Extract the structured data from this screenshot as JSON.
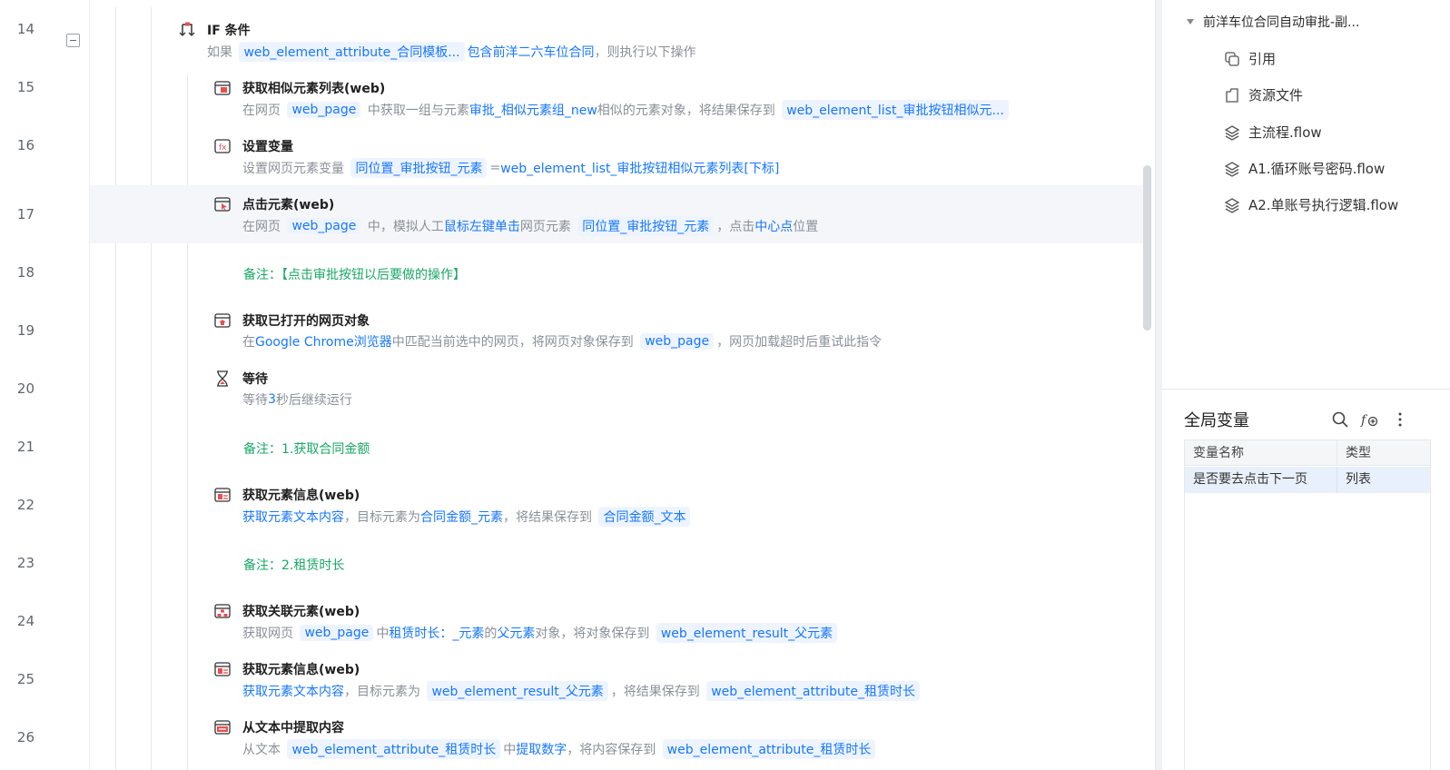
{
  "rows": [
    {
      "line": "14",
      "title": "IF 条件",
      "desc": [
        {
          "t": "如果 "
        },
        {
          "t": "web_element_attribute_合同模板...",
          "c": "tag"
        },
        {
          "t": "包含",
          "c": "kw"
        },
        {
          "t": "前洋二六车位合同",
          "c": "kw"
        },
        {
          "t": "，则执行以下操作"
        }
      ]
    },
    {
      "line": "15",
      "title": "获取相似元素列表(web)",
      "desc": [
        {
          "t": "在网页 "
        },
        {
          "t": "web_page",
          "c": "tag"
        },
        {
          "t": " 中获取一组与元素"
        },
        {
          "t": "审批_相似元素组_new",
          "c": "kw"
        },
        {
          "t": "相似的元素对象，将结果保存到 "
        },
        {
          "t": "web_element_list_审批按钮相似元...",
          "c": "tag"
        }
      ]
    },
    {
      "line": "16",
      "title": "设置变量",
      "desc": [
        {
          "t": "设置网页元素变量 "
        },
        {
          "t": "同位置_审批按钮_元素",
          "c": "tag"
        },
        {
          "t": "="
        },
        {
          "t": "web_element_list_审批按钮相似元素列表[下标]",
          "c": "kw"
        }
      ]
    },
    {
      "line": "17",
      "title": "点击元素(web)",
      "desc": [
        {
          "t": "在网页 "
        },
        {
          "t": "web_page",
          "c": "tag"
        },
        {
          "t": " 中，模拟人工"
        },
        {
          "t": "鼠标左键单击",
          "c": "kw"
        },
        {
          "t": "网页元素 "
        },
        {
          "t": "同位置_审批按钮_元素",
          "c": "tag"
        },
        {
          "t": "，点击"
        },
        {
          "t": "中心点",
          "c": "kw"
        },
        {
          "t": "位置"
        }
      ]
    },
    {
      "line": "18",
      "note": "备注：【点击审批按钮以后要做的操作】"
    },
    {
      "line": "19",
      "title": "获取已打开的网页对象",
      "desc": [
        {
          "t": "在"
        },
        {
          "t": "Google Chrome浏览器",
          "c": "kw"
        },
        {
          "t": "中匹配当前选中的网页，将网页对象保存到 "
        },
        {
          "t": "web_page",
          "c": "tag"
        },
        {
          "t": "，网页加载超时后重试此指令"
        }
      ]
    },
    {
      "line": "20",
      "title": "等待",
      "desc": [
        {
          "t": "等待"
        },
        {
          "t": "3",
          "c": "kw"
        },
        {
          "t": "秒后继续运行"
        }
      ]
    },
    {
      "line": "21",
      "note": "备注：1.获取合同金额"
    },
    {
      "line": "22",
      "title": "获取元素信息(web)",
      "desc": [
        {
          "t": "获取元素文本内容",
          "c": "kw"
        },
        {
          "t": "，目标元素为"
        },
        {
          "t": "合同金额_元素",
          "c": "kw"
        },
        {
          "t": "，将结果保存到 "
        },
        {
          "t": "合同金额_文本",
          "c": "tag"
        }
      ]
    },
    {
      "line": "23",
      "note": "备注：2.租赁时长"
    },
    {
      "line": "24",
      "title": "获取关联元素(web)",
      "desc": [
        {
          "t": "获取网页 "
        },
        {
          "t": "web_page",
          "c": "tag"
        },
        {
          "t": "中"
        },
        {
          "t": "租赁时长：_元素",
          "c": "kw"
        },
        {
          "t": "的"
        },
        {
          "t": "父元素",
          "c": "kw"
        },
        {
          "t": "对象，将对象保存到 "
        },
        {
          "t": "web_element_result_父元素",
          "c": "tag"
        }
      ]
    },
    {
      "line": "25",
      "title": "获取元素信息(web)",
      "desc": [
        {
          "t": "获取元素文本内容",
          "c": "kw"
        },
        {
          "t": "，目标元素为 "
        },
        {
          "t": "web_element_result_父元素",
          "c": "tag"
        },
        {
          "t": "，将结果保存到 "
        },
        {
          "t": "web_element_attribute_租赁时长",
          "c": "tag"
        }
      ]
    },
    {
      "line": "26",
      "title": "从文本中提取内容",
      "desc": [
        {
          "t": "从文本 "
        },
        {
          "t": "web_element_attribute_租赁时长",
          "c": "tag"
        },
        {
          "t": "中"
        },
        {
          "t": "提取数字",
          "c": "kw"
        },
        {
          "t": "，将内容保存到 "
        },
        {
          "t": "web_element_attribute_租赁时长",
          "c": "tag"
        }
      ]
    }
  ],
  "tree": {
    "root": "前洋车位合同自动审批-副...",
    "items": [
      "引用",
      "资源文件",
      "主流程.flow",
      "A1.循环账号密码.flow",
      "A2.单账号执行逻辑.flow"
    ]
  },
  "globals": {
    "title": "全局变量",
    "col_name": "变量名称",
    "col_type": "类型",
    "rows": [
      {
        "name": "是否要去点击下一页",
        "type": "列表"
      }
    ]
  }
}
